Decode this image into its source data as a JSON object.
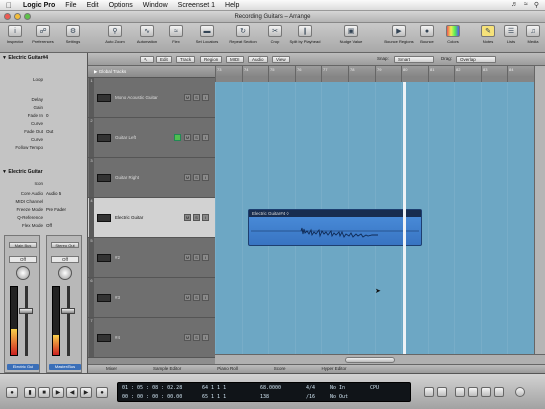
{
  "menubar": {
    "app_name": "Logic Pro",
    "items": [
      "File",
      "Edit",
      "Options",
      "Window",
      "Screenset 1",
      "Help"
    ]
  },
  "window": {
    "title": "Recording Guitars – Arrange"
  },
  "toolbar": {
    "buttons": [
      "Inspector",
      "Preferences",
      "Settings",
      "Auto Zoom",
      "Automation",
      "Flex",
      "Set Locators",
      "Repeat Section",
      "Crop",
      "Split by Playhead",
      "Bounce Regions",
      "Bounce",
      "Colors",
      "Notes",
      "Lists",
      "Media"
    ],
    "bounce_region_label": "Bounce Regions"
  },
  "inspector": {
    "region_header": "Electric Guitar#4",
    "region_params": [
      {
        "k": "Mute",
        "v": ""
      },
      {
        "k": "Loop",
        "v": ""
      },
      {
        "k": "Delay",
        "v": ""
      },
      {
        "k": "Gain",
        "v": ""
      },
      {
        "k": "Fade In",
        "v": "0"
      },
      {
        "k": "Curve",
        "v": ""
      },
      {
        "k": "Fade Out",
        "v": "Out"
      },
      {
        "k": "Curve",
        "v": ""
      },
      {
        "k": "Follow Tempo",
        "v": ""
      }
    ],
    "track_header": "Electric Guitar",
    "track_params": [
      {
        "k": "Icon",
        "v": ""
      },
      {
        "k": "Core Audio",
        "v": "Audio 5"
      },
      {
        "k": "MIDI Channel",
        "v": ""
      },
      {
        "k": "Freeze Mode",
        "v": "Pre Fader"
      },
      {
        "k": "Q-Reference",
        "v": ""
      },
      {
        "k": "Flex Mode",
        "v": "Off"
      }
    ]
  },
  "channel_strips": [
    {
      "insert": "Main Bus",
      "send": "Off",
      "name": "Electric Gui"
    },
    {
      "insert": "Stereo Out",
      "send": "Off",
      "name": "Master/Bus"
    }
  ],
  "arrange_bar": {
    "items": [
      "Global Tracks",
      "Edit",
      "Track",
      "Region",
      "MIDI",
      "Audio",
      "View",
      "Snap:",
      "Smart",
      "Drag:",
      "Overlap"
    ]
  },
  "ruler": {
    "marks": [
      "73",
      "74",
      "75",
      "76",
      "77",
      "78",
      "79",
      "80",
      "81",
      "82",
      "83",
      "84"
    ]
  },
  "tracks": [
    {
      "num": "1",
      "name": "Mono Acoustic Guitar",
      "selected": false,
      "rec": false
    },
    {
      "num": "2",
      "name": "Guitar Left",
      "selected": false,
      "rec": true
    },
    {
      "num": "3",
      "name": "Guitar Right",
      "selected": false,
      "rec": false
    },
    {
      "num": "4",
      "name": "Electric Guitar",
      "selected": true,
      "rec": false
    },
    {
      "num": "5",
      "name": "#2",
      "selected": false,
      "rec": false
    },
    {
      "num": "6",
      "name": "#3",
      "selected": false,
      "rec": false
    },
    {
      "num": "7",
      "name": "#4",
      "selected": false,
      "rec": false
    }
  ],
  "region": {
    "name": "Electric Guitar#4 ◊"
  },
  "editor_tabs": [
    "Mixer",
    "Sample Editor",
    "Piano Roll",
    "Score",
    "Hyper Editor"
  ],
  "transport": {
    "smpte": "01 : 05 : 08 : 02.28",
    "bar_pos": "64 1 1 1",
    "bar_pos2": "65 1 1 1",
    "smpte2": "00 : 00 : 00 : 00.00",
    "tempo": "68.0000",
    "tempo2": "138",
    "sig": "4/4",
    "div": "/16",
    "in": "No In",
    "out": "No Out",
    "cpu_label": "CPU"
  },
  "colors": {
    "accent": "#3b6fb8",
    "canvas": "#6da7c4",
    "region": "#3874c2"
  }
}
